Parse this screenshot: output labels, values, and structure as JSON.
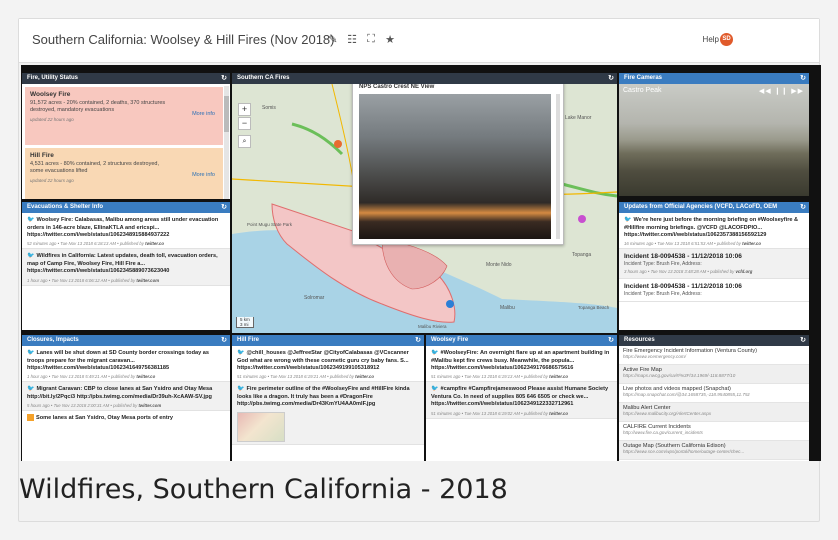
{
  "header": {
    "title": "Southern California: Woolsey & Hill Fires (Nov 2018)",
    "help_label": "Help",
    "avatar_initials": "SD"
  },
  "panels": {
    "fire_status": {
      "title": "Fire, Utility Status",
      "items": [
        {
          "name": "Woolsey Fire",
          "desc": "91,572 acres - 20% contained, 2 deaths, 370 structures destroyed, mandatory evacuations",
          "updated": "updated 22 hours ago",
          "more": "More info"
        },
        {
          "name": "Hill Fire",
          "desc": "4,531 acres - 80% contained, 2 structures destroyed, some evacuations lifted",
          "updated": "updated 22 hours ago",
          "more": "More info"
        }
      ]
    },
    "map": {
      "title": "Southern CA Fires",
      "popup_title": "NPS Castro Crest NE View",
      "scale_km": "5 km",
      "scale_mi": "3 mi",
      "labels": [
        "Somis",
        "Lake Manor",
        "Point Mugu State Park",
        "Topanga",
        "Monte Nido",
        "Malibu",
        "Topanga Beach",
        "Solromar",
        "Malibu Riviera",
        "Camarillo"
      ]
    },
    "cameras": {
      "title": "Fire Cameras",
      "camera_name": "Castro Peak",
      "controls": "◀◀ ❙❙ ▶▶"
    },
    "evacuations": {
      "title": "Evacuations & Shelter Info",
      "tweets": [
        {
          "text": "Woolsey Fire: Calabasas, Malibu among areas still under evacuation orders in 146-acre blaze, EllinaKTLA and ericspi... https://twitter.com/i/web/status/1062348915884937222",
          "meta": "52 minutes ago • Tue Nov 13 2018 6:18:13 AM • published by",
          "source": "twitter.co"
        },
        {
          "text": "Wildfires in California: Latest updates, death toll, evacuation orders, map of Camp Fire, Woolsey Fire, Hill Fire a... https://twitter.com/i/web/status/1062345889073623040",
          "meta": "1 hour ago • Tue Nov 13 2018 6:06:12 AM • published by",
          "source": "twitter.com"
        }
      ]
    },
    "official": {
      "title": "Updates from Official Agencies (VCFD, LACoFD, OEM",
      "tweets": [
        {
          "text": "We're here just before the morning briefing on #Woolseyfire & #Hillfire morning briefings. @VCFD @LACOFDPIO... https://twitter.com/i/web/status/1062357388156592129",
          "meta": "16 minutes ago • Tue Nov 13 2018 6:51:53 AM • published by",
          "source": "twitter.co"
        }
      ],
      "incidents": [
        {
          "title": "Incident 18-0094538 - 11/12/2018 10:06",
          "type": "Incident Type: Brush Fire, Address:",
          "meta": "3 hours ago • Tue Nov 13 2018 3:48:28 AM • published by",
          "source": "vcfd.org"
        },
        {
          "title": "Incident 18-0094538 - 11/12/2018 10:06",
          "type": "Incident Type: Brush Fire, Address:"
        }
      ]
    },
    "closures": {
      "title": "Closures, Impacts",
      "tweets": [
        {
          "text": "Lanes will be shut down at SD County border crossings today as troops prepare for the migrant caravan... https://twitter.com/i/web/status/1062341649756381185",
          "meta": "1 hour ago • Tue Nov 13 2018 5:49:21 AM • published by",
          "source": "twitter.co"
        },
        {
          "text": "Migrant Caravan: CBP to close lanes at San Ysidro and Otay Mesa http://bit.ly/2Pqci3 http://pbs.twimg.com/media/Dr39uh-XcAAW-SV.jpg",
          "meta": "5 hours ago • Tue Nov 13 2018 2:00:31 AM • published by",
          "source": "twitter.com"
        }
      ],
      "folded": "Some lanes at San Ysidro, Otay Mesa ports of entry"
    },
    "hill_fire": {
      "title": "Hill Fire",
      "tweets": [
        {
          "text": "@chill_houses @JeffreeStar @CityofCalabasas @VCscanner God what are wrong with these cosmetic guru cry baby fans. S... https://twitter.com/i/web/status/1062349199105318912",
          "meta": "51 minutes ago • Tue Nov 13 2018 6:19:21 AM • published by",
          "source": "twitter.co"
        },
        {
          "text": "Fire perimeter outline of the #WoolseyFire and #HillFire kinda looks like a dragon. It truly has been a #DragonFire http://pbs.twimg.com/media/Dr43KmYU4AA0mIF.jpg"
        }
      ]
    },
    "woolsey_fire": {
      "title": "Woolsey Fire",
      "tweets": [
        {
          "text": "#WoolseyFire: An overnight flare up at an apartment building in #Malibu kept fire crews busy. Meanwhile, the popula... https://twitter.com/i/web/status/1062349176686575616",
          "meta": "51 minutes ago • Tue Nov 13 2018 6:19:13 AM • published by",
          "source": "twitter.co"
        },
        {
          "text": "#campfire #Campfirejameswood Please assist Humane Society Ventura Co. In need of supplies 805 646 6505 or check we... https://twitter.com/i/web/status/1062349122332712961",
          "meta": "51 minutes ago • Tue Nov 13 2018 6:19:02 AM • published by",
          "source": "twitter.co"
        }
      ]
    },
    "resources": {
      "title": "Resources",
      "items": [
        {
          "name": "Fire Emergency Incident Information (Ventura County)",
          "url": "https://www.vcemergency.com/"
        },
        {
          "name": "Active Fire Map",
          "url": "https://maps.nwcg.gov/sa/#/%3F/34.1969/-118.8877/10"
        },
        {
          "name": "Live photos and videos mapped (Snapchat)",
          "url": "https://map.snapchat.com/@34.1658735,-118.9540855,11.75z"
        },
        {
          "name": "Malibu Alert Center",
          "url": "https://www.malibucity.org/AlertCenter.aspx"
        },
        {
          "name": "CALFIRE Current Incidents",
          "url": "http://www.fire.ca.gov/current_incidents"
        },
        {
          "name": "Outage Map (Southern California Edison)",
          "url": "https://www.sce.com/wps/portal/home/outage-center/chec..."
        }
      ]
    }
  },
  "caption": "Wildfires, Southern California - 2018"
}
